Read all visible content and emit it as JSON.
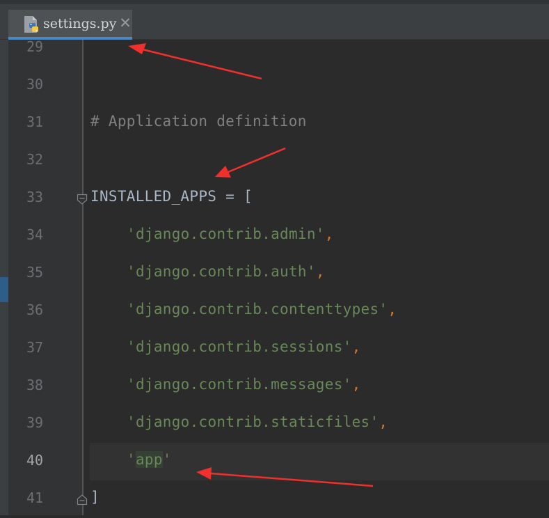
{
  "tab": {
    "filename": "settings.py",
    "icon": "python-file-icon",
    "close_glyph": "✕"
  },
  "editor": {
    "current_line": 40,
    "lines": [
      {
        "no": "29"
      },
      {
        "no": "30"
      },
      {
        "no": "31",
        "comment": "# Application definition"
      },
      {
        "no": "32"
      },
      {
        "no": "33",
        "ident": "INSTALLED_APPS",
        "op": " = ",
        "bracket": "["
      },
      {
        "no": "34",
        "str": "'django.contrib.admin'",
        "comma": ","
      },
      {
        "no": "35",
        "str": "'django.contrib.auth'",
        "comma": ","
      },
      {
        "no": "36",
        "str": "'django.contrib.contenttypes'",
        "comma": ","
      },
      {
        "no": "37",
        "str": "'django.contrib.sessions'",
        "comma": ","
      },
      {
        "no": "38",
        "str": "'django.contrib.messages'",
        "comma": ","
      },
      {
        "no": "39",
        "str": "'django.contrib.staticfiles'",
        "comma": ","
      },
      {
        "no": "40",
        "q1": "'",
        "word": "app",
        "q2": "'"
      },
      {
        "no": "41",
        "bracket": "]"
      }
    ]
  },
  "colors": {
    "background": "#2b2b2b",
    "gutter": "#313335",
    "string": "#6a8759",
    "comment": "#808080",
    "punctuation": "#cc7832",
    "identifier": "#a9b7c6",
    "annotation_arrow": "#f0302c"
  }
}
